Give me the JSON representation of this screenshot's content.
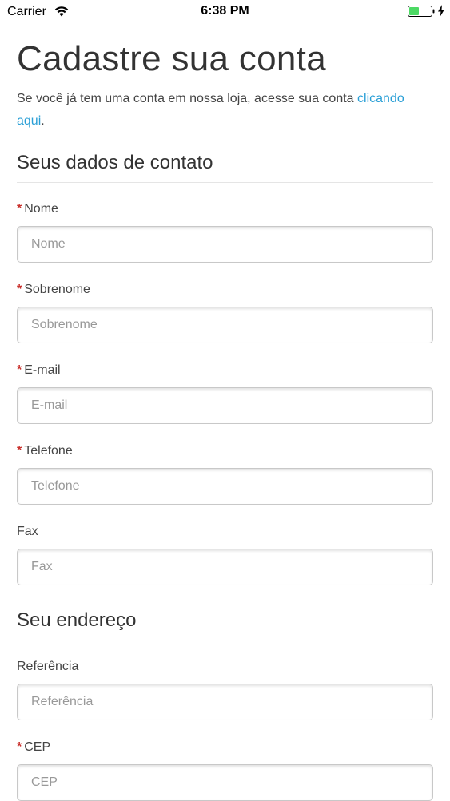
{
  "status_bar": {
    "carrier": "Carrier",
    "time": "6:38 PM",
    "wifi_icon": "wifi-icon",
    "battery_icon": "battery-icon",
    "battery_color": "#4cd964"
  },
  "page": {
    "title": "Cadastre sua conta",
    "intro_text": "Se você já tem uma conta em nossa loja, acesse sua conta ",
    "intro_link": "clicando aqui",
    "intro_end": ".",
    "link_color": "#2a9fd6",
    "required_color": "#c9302c"
  },
  "contact": {
    "title": "Seus dados de contato",
    "nome": {
      "label": "Nome",
      "placeholder": "Nome",
      "required_mark": "*"
    },
    "sobrenome": {
      "label": "Sobrenome",
      "placeholder": "Sobrenome",
      "required_mark": "*"
    },
    "email": {
      "label": "E-mail",
      "placeholder": "E-mail",
      "required_mark": "*"
    },
    "telefone": {
      "label": "Telefone",
      "placeholder": "Telefone",
      "required_mark": "*"
    },
    "fax": {
      "label": "Fax",
      "placeholder": "Fax"
    }
  },
  "address": {
    "title": "Seu endereço",
    "referencia": {
      "label": "Referência",
      "placeholder": "Referência"
    },
    "cep": {
      "label": "CEP",
      "placeholder": "CEP",
      "required_mark": "*"
    }
  }
}
